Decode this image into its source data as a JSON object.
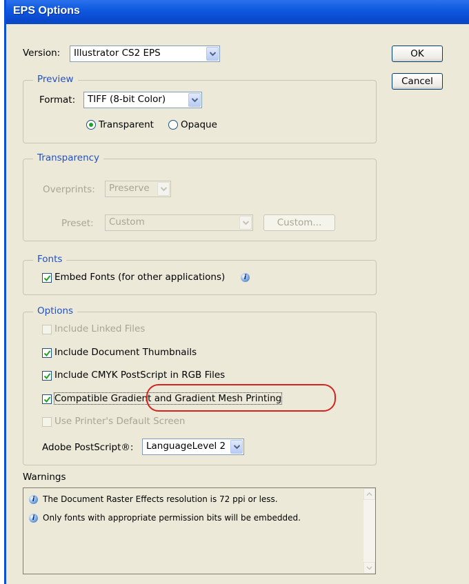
{
  "window": {
    "title": "EPS Options"
  },
  "version": {
    "label": "Version:",
    "value": "Illustrator CS2 EPS"
  },
  "buttons": {
    "ok": "OK",
    "cancel": "Cancel"
  },
  "preview": {
    "legend": "Preview",
    "format_label": "Format:",
    "format_value": "TIFF (8-bit Color)",
    "radio_transparent": "Transparent",
    "radio_opaque": "Opaque",
    "selected": "Transparent"
  },
  "transparency": {
    "legend": "Transparency",
    "overprints_label": "Overprints:",
    "overprints_value": "Preserve",
    "preset_label": "Preset:",
    "preset_value": "Custom",
    "custom_button": "Custom..."
  },
  "fonts": {
    "legend": "Fonts",
    "embed_label": "Embed Fonts (for other applications)",
    "embed_checked": true
  },
  "options": {
    "legend": "Options",
    "items": [
      {
        "label": "Include Linked Files",
        "checked": false,
        "enabled": false
      },
      {
        "label": "Include Document Thumbnails",
        "checked": true,
        "enabled": true
      },
      {
        "label": "Include CMYK PostScript in RGB Files",
        "checked": true,
        "enabled": true
      },
      {
        "label": "Compatible Gradient and Gradient Mesh Printing",
        "checked": true,
        "enabled": true
      },
      {
        "label": "Use Printer's Default Screen",
        "checked": false,
        "enabled": false
      }
    ],
    "postscript_label": "Adobe PostScript®:",
    "postscript_value": "LanguageLevel 2"
  },
  "warnings": {
    "label": "Warnings",
    "items": [
      "The Document Raster Effects resolution is 72 ppi or less.",
      "Only fonts with appropriate permission bits will be embedded."
    ]
  },
  "colors": {
    "highlight": "#d6211c",
    "titlebar": "#0a49cf",
    "legend_text": "#2150c2"
  }
}
